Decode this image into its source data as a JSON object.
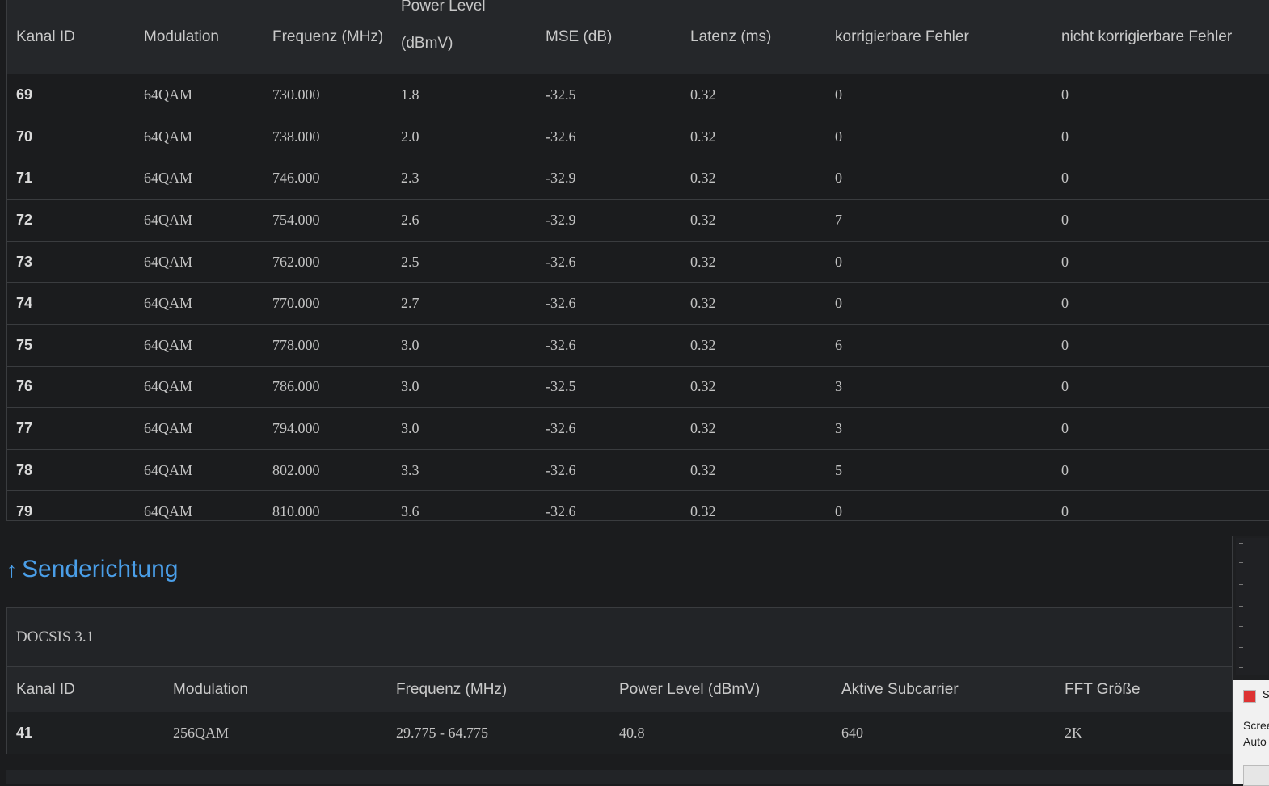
{
  "downstream": {
    "headers": [
      "Kanal ID",
      "Modulation",
      "Frequenz (MHz)",
      "Power Level",
      "(dBmV)",
      "MSE (dB)",
      "Latenz (ms)",
      "korrigierbare Fehler",
      "nicht korrigierbare Fehler"
    ],
    "rows": [
      [
        "69",
        "64QAM",
        "730.000",
        "1.8",
        "-32.5",
        "0.32",
        "0",
        "0"
      ],
      [
        "70",
        "64QAM",
        "738.000",
        "2.0",
        "-32.6",
        "0.32",
        "0",
        "0"
      ],
      [
        "71",
        "64QAM",
        "746.000",
        "2.3",
        "-32.9",
        "0.32",
        "0",
        "0"
      ],
      [
        "72",
        "64QAM",
        "754.000",
        "2.6",
        "-32.9",
        "0.32",
        "7",
        "0"
      ],
      [
        "73",
        "64QAM",
        "762.000",
        "2.5",
        "-32.6",
        "0.32",
        "0",
        "0"
      ],
      [
        "74",
        "64QAM",
        "770.000",
        "2.7",
        "-32.6",
        "0.32",
        "0",
        "0"
      ],
      [
        "75",
        "64QAM",
        "778.000",
        "3.0",
        "-32.6",
        "0.32",
        "6",
        "0"
      ],
      [
        "76",
        "64QAM",
        "786.000",
        "3.0",
        "-32.5",
        "0.32",
        "3",
        "0"
      ],
      [
        "77",
        "64QAM",
        "794.000",
        "3.0",
        "-32.6",
        "0.32",
        "3",
        "0"
      ],
      [
        "78",
        "64QAM",
        "802.000",
        "3.3",
        "-32.6",
        "0.32",
        "5",
        "0"
      ],
      [
        "79",
        "64QAM",
        "810.000",
        "3.6",
        "-32.6",
        "0.32",
        "0",
        "0"
      ]
    ]
  },
  "upstream": {
    "title_arrow": "↑",
    "title": "Senderichtung",
    "docsis_label": "DOCSIS 3.1",
    "headers": [
      "Kanal ID",
      "Modulation",
      "Frequenz (MHz)",
      "Power Level (dBmV)",
      "Aktive Subcarrier",
      "FFT Größe"
    ],
    "rows": [
      [
        "41",
        "256QAM",
        "29.775 - 64.775",
        "40.8",
        "640",
        "2K"
      ]
    ]
  },
  "notification": {
    "app_letter": "S",
    "line1": "Scree",
    "line2": "Auto"
  },
  "colors": {
    "background": "#1b1c1e",
    "header_bg": "#25272a",
    "accent": "#4a9ee8",
    "border": "#3a3c3f"
  }
}
